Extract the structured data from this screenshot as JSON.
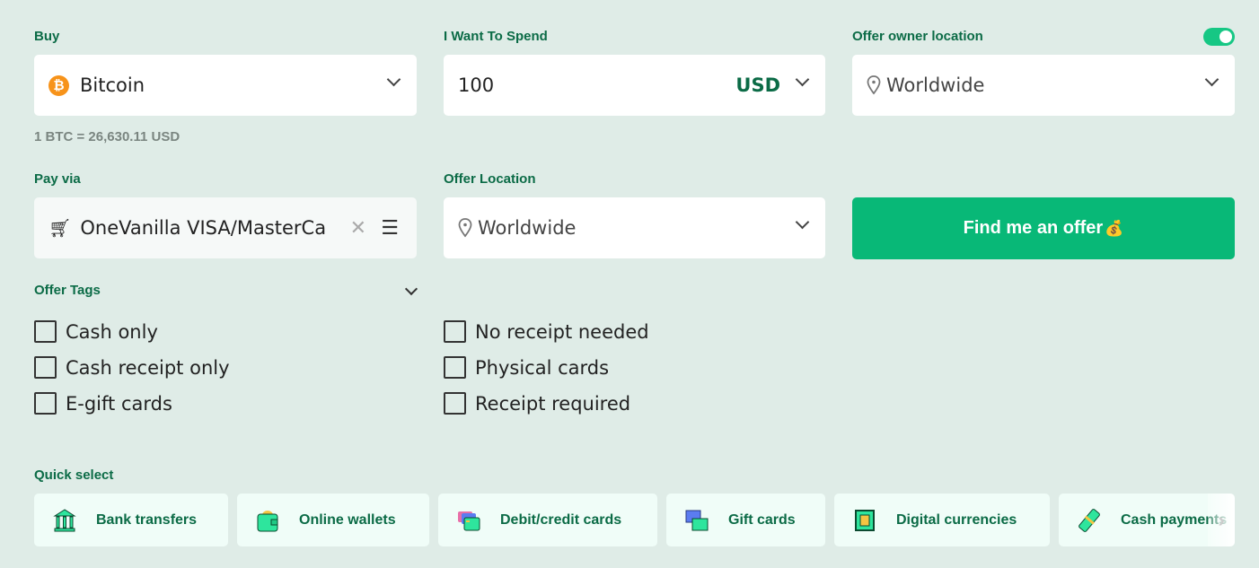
{
  "buy": {
    "label": "Buy",
    "value": "Bitcoin",
    "rate": "1 BTC = 26,630.11 USD"
  },
  "spend": {
    "label": "I Want To Spend",
    "amount": "100",
    "currency": "USD"
  },
  "owner_location": {
    "label": "Offer owner location",
    "value": "Worldwide",
    "toggle_on": true
  },
  "pay_via": {
    "label": "Pay via",
    "value": "OneVanilla VISA/MasterCa"
  },
  "offer_location": {
    "label": "Offer Location",
    "value": "Worldwide"
  },
  "find_button": {
    "label": "Find me an offer",
    "emoji": "💰"
  },
  "offer_tags": {
    "label": "Offer Tags",
    "items": [
      "Cash only",
      "Cash receipt only",
      "E-gift cards",
      "No receipt needed",
      "Physical cards",
      "Receipt required"
    ]
  },
  "quick_select": {
    "label": "Quick select",
    "items": [
      {
        "label": "Bank transfers",
        "icon": "bank-icon"
      },
      {
        "label": "Online wallets",
        "icon": "wallet-icon"
      },
      {
        "label": "Debit/credit cards",
        "icon": "credit-card-icon"
      },
      {
        "label": "Gift cards",
        "icon": "gift-card-icon"
      },
      {
        "label": "Digital currencies",
        "icon": "chip-icon"
      },
      {
        "label": "Cash payments",
        "icon": "cash-icon"
      }
    ]
  },
  "colors": {
    "accent": "#08b877",
    "label": "#0b6b46",
    "background": "#dfece7"
  }
}
